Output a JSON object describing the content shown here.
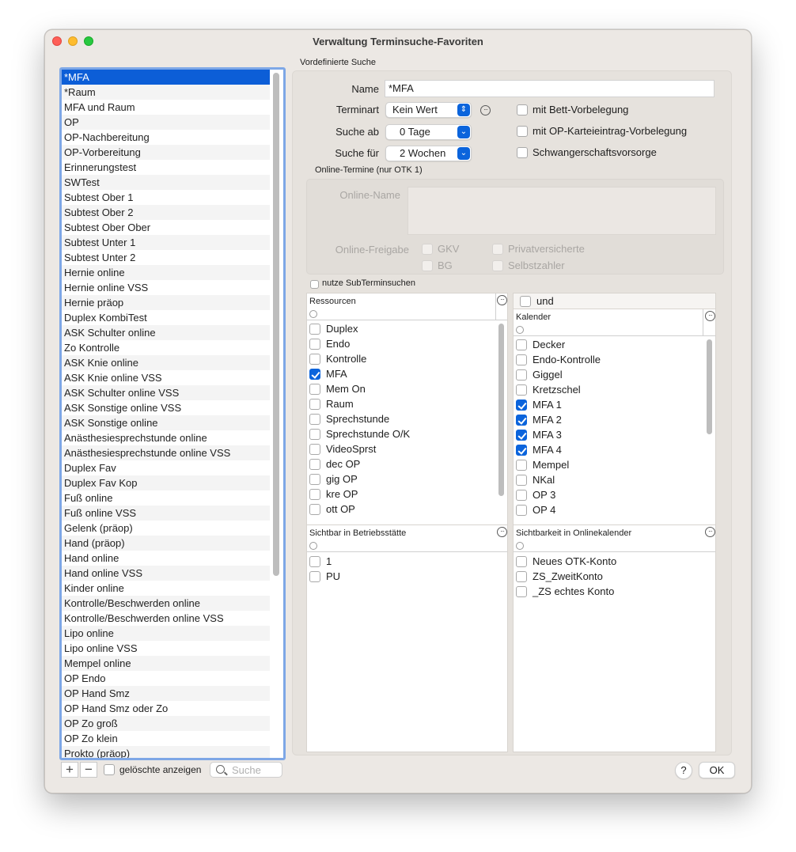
{
  "window": {
    "title": "Verwaltung Terminsuche-Favoriten"
  },
  "favorites": {
    "items": [
      "*MFA",
      "*Raum",
      "MFA und Raum",
      "OP",
      "OP-Nachbereitung",
      "OP-Vorbereitung",
      "Erinnerungstest",
      "SWTest",
      "Subtest Ober 1",
      "Subtest Ober 2",
      "Subtest Ober Ober",
      "Subtest Unter 1",
      "Subtest Unter 2",
      "Hernie online",
      "Hernie online VSS",
      "Hernie präop",
      "Duplex KombiTest",
      "ASK Schulter online",
      "Zo Kontrolle",
      "ASK Knie online",
      "ASK Knie online VSS",
      "ASK Schulter online VSS",
      "ASK Sonstige online VSS",
      "ASK Sonstige online",
      "Anästhesiesprechstunde online",
      "Anästhesiesprechstunde online VSS",
      "Duplex Fav",
      "Duplex Fav Kop",
      "Fuß online",
      "Fuß online VSS",
      "Gelenk (präop)",
      "Hand (präop)",
      "Hand online",
      "Hand online VSS",
      "Kinder online",
      "Kontrolle/Beschwerden online",
      "Kontrolle/Beschwerden online VSS",
      "Lipo online",
      "Lipo online VSS",
      "Mempel online",
      "OP Endo",
      "OP Hand Smz",
      "OP Hand Smz oder Zo",
      "OP Zo groß",
      "OP Zo klein",
      "Prokto (präop)"
    ],
    "selected_index": 0
  },
  "bottom_bar": {
    "add_label": "+",
    "remove_label": "−",
    "show_deleted_label": "gelöschte anzeigen",
    "search_placeholder": "Suche"
  },
  "section_title": "Vordefinierte Suche",
  "form": {
    "name_label": "Name",
    "name_value": "*MFA",
    "terminart_label": "Terminart",
    "terminart_value": "Kein Wert",
    "suche_ab_label": "Suche ab",
    "suche_ab_value": "0 Tage",
    "suche_fuer_label": "Suche für",
    "suche_fuer_value": "2 Wochen",
    "bett_label": "mit Bett-Vorbelegung",
    "op_kartei_label": "mit OP-Karteieintrag-Vorbelegung",
    "schwanger_label": "Schwangerschaftsvorsorge"
  },
  "online": {
    "section_label": "Online-Termine (nur OTK 1)",
    "name_label": "Online-Name",
    "freigabe_label": "Online-Freigabe",
    "gkv_label": "GKV",
    "privat_label": "Privatversicherte",
    "bg_label": "BG",
    "selbst_label": "Selbstzahler"
  },
  "sub_search_label": "nutze SubTerminsuchen",
  "resources": {
    "header": "Ressourcen",
    "items": [
      {
        "label": "Duplex",
        "checked": false
      },
      {
        "label": "Endo",
        "checked": false
      },
      {
        "label": "Kontrolle",
        "checked": false
      },
      {
        "label": "MFA",
        "checked": true
      },
      {
        "label": "Mem On",
        "checked": false
      },
      {
        "label": "Raum",
        "checked": false
      },
      {
        "label": "Sprechstunde",
        "checked": false
      },
      {
        "label": "Sprechstunde O/K",
        "checked": false
      },
      {
        "label": "VideoSprst",
        "checked": false
      },
      {
        "label": "dec OP",
        "checked": false
      },
      {
        "label": "gig OP",
        "checked": false
      },
      {
        "label": "kre OP",
        "checked": false
      },
      {
        "label": "ott OP",
        "checked": false
      }
    ]
  },
  "und_label": "und",
  "calendars": {
    "header": "Kalender",
    "items": [
      {
        "label": "Decker",
        "checked": false
      },
      {
        "label": "Endo-Kontrolle",
        "checked": false
      },
      {
        "label": "Giggel",
        "checked": false
      },
      {
        "label": "Kretzschel",
        "checked": false
      },
      {
        "label": "MFA 1",
        "checked": true
      },
      {
        "label": "MFA 2",
        "checked": true
      },
      {
        "label": "MFA 3",
        "checked": true
      },
      {
        "label": "MFA 4",
        "checked": true
      },
      {
        "label": "Mempel",
        "checked": false
      },
      {
        "label": "NKal",
        "checked": false
      },
      {
        "label": "OP 3",
        "checked": false
      },
      {
        "label": "OP 4",
        "checked": false
      }
    ]
  },
  "betriebsstaette": {
    "header": "Sichtbar in Betriebsstätte",
    "items": [
      {
        "label": "1",
        "checked": false
      },
      {
        "label": "PU",
        "checked": false
      }
    ]
  },
  "onlinekalender": {
    "header": "Sichtbarkeit in Onlinekalender",
    "items": [
      {
        "label": "Neues OTK-Konto",
        "checked": false
      },
      {
        "label": "ZS_ZweitKonto",
        "checked": false
      },
      {
        "label": "_ZS echtes Konto",
        "checked": false
      }
    ]
  },
  "buttons": {
    "help_label": "?",
    "ok_label": "OK"
  }
}
